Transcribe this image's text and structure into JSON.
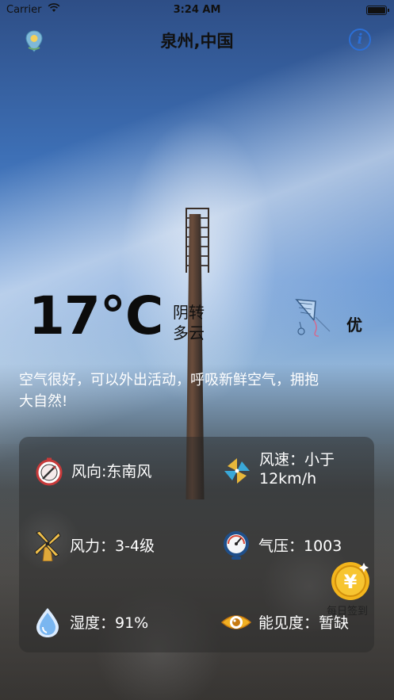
{
  "status_bar": {
    "carrier": "Carrier",
    "time": "3:24 AM"
  },
  "header": {
    "city": "泉州,中国",
    "info_icon": "i"
  },
  "weather": {
    "temperature": "17°C",
    "condition": "阴转多云",
    "aqi_level": "优",
    "advice": "空气很好，可以外出活动，呼吸新鲜空气，拥抱大自然!"
  },
  "details": {
    "wind_direction": "风向:东南风",
    "wind_speed": "风速：小于12km/h",
    "wind_force": "风力：3-4级",
    "pressure": "气压：1003",
    "humidity": "湿度：91%",
    "visibility": "能见度：暂缺"
  },
  "checkin": {
    "label": "每日签到"
  },
  "icons": {
    "location": "location-pin-icon",
    "info": "info-icon",
    "kite": "kite-icon",
    "wind_direction": "compass-icon",
    "wind_speed": "pinwheel-icon",
    "wind_force": "windmill-icon",
    "pressure": "barometer-icon",
    "humidity": "water-drop-icon",
    "visibility": "eye-icon",
    "coin": "coin-icon"
  }
}
